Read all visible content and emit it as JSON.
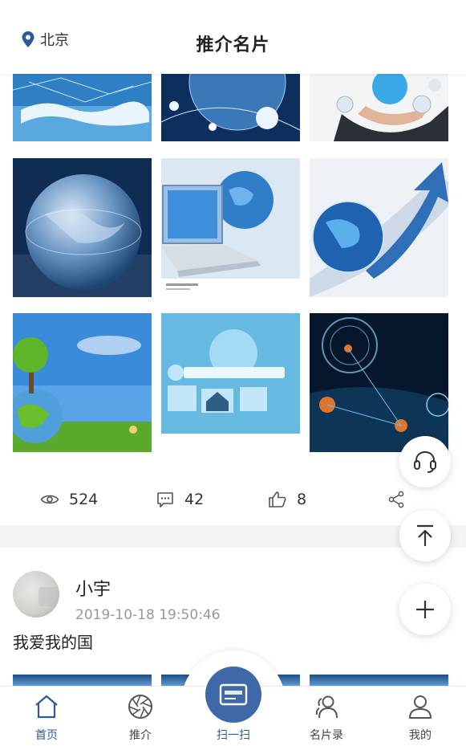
{
  "header": {
    "location": "北京",
    "title": "推介名片"
  },
  "gallery": {
    "images": [
      {
        "name": "world-map-network"
      },
      {
        "name": "globe-network-lines"
      },
      {
        "name": "hand-holding-globe-icons"
      },
      {
        "name": "glass-globe-keyboard"
      },
      {
        "name": "laptop-with-globe"
      },
      {
        "name": "globe-with-arrow"
      },
      {
        "name": "green-earth-nature"
      },
      {
        "name": "digital-search-interface"
      },
      {
        "name": "city-night-network"
      }
    ]
  },
  "stats": {
    "views": "524",
    "comments": "42",
    "likes": "8"
  },
  "post": {
    "author": "小宇",
    "time": "2019-10-18 19:50:46",
    "text": "我爱我的国"
  },
  "tabbar": {
    "home": "首页",
    "recommend": "推介",
    "scan": "扫一扫",
    "cards": "名片录",
    "mine": "我的"
  },
  "colors": {
    "accent": "#3f68a8",
    "active_label": "#2c5a96"
  }
}
